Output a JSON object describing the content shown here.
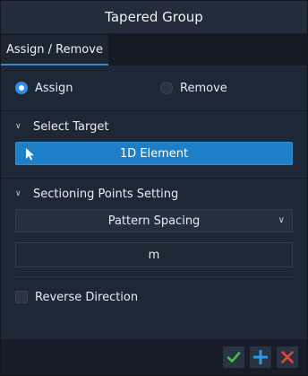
{
  "window": {
    "title": "Tapered Group"
  },
  "tabs": [
    {
      "label": "Assign / Remove"
    }
  ],
  "mode": {
    "options": [
      {
        "label": "Assign",
        "selected": true
      },
      {
        "label": "Remove",
        "selected": false
      }
    ]
  },
  "select_target": {
    "header": "Select Target",
    "button_label": "1D Element"
  },
  "sectioning": {
    "header": "Sectioning Points Setting",
    "dropdown_value": "Pattern Spacing",
    "input_value": "m"
  },
  "reverse_direction": {
    "label": "Reverse Direction",
    "checked": false
  },
  "footer": {
    "icons": [
      "check-icon",
      "plus-icon",
      "close-icon"
    ]
  },
  "colors": {
    "accent": "#1f7ec8",
    "confirm": "#3cc24a",
    "add": "#2b9ae6",
    "cancel": "#e0473b"
  }
}
